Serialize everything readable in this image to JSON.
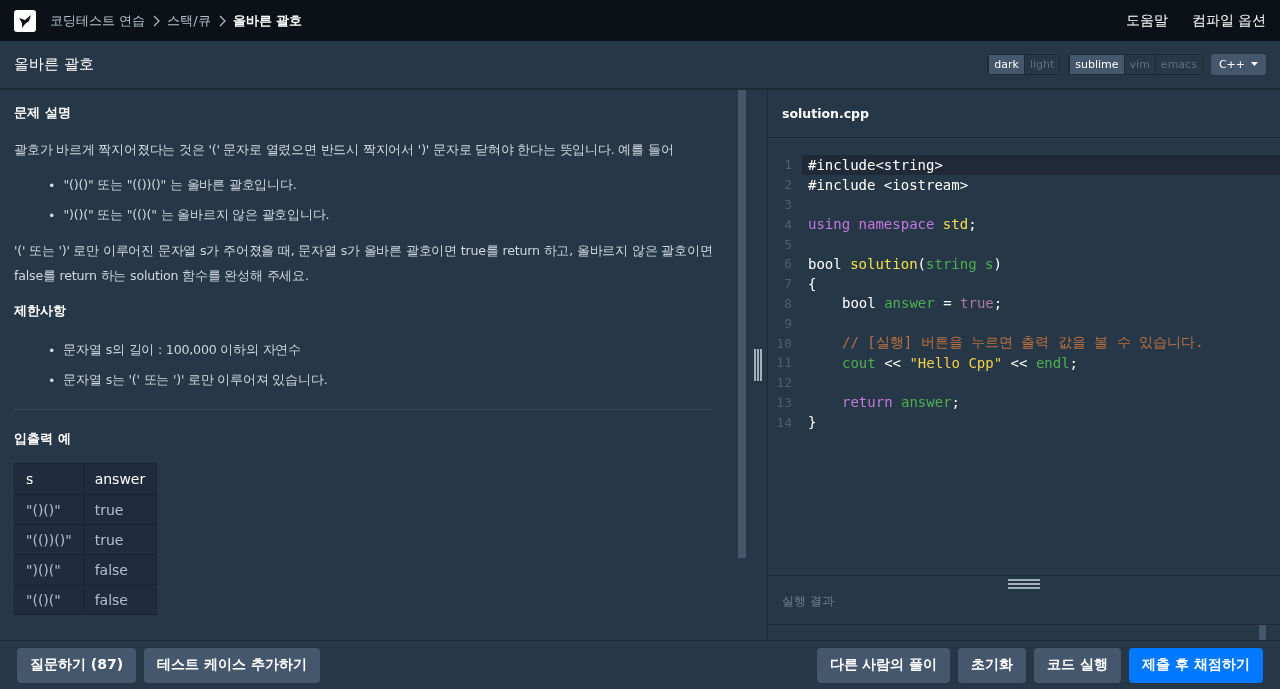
{
  "nav": {
    "breadcrumbs": [
      {
        "label": "코딩테스트 연습",
        "current": false
      },
      {
        "label": "스택/큐",
        "current": false
      },
      {
        "label": "올바른 괄호",
        "current": true
      }
    ],
    "links": [
      "도움말",
      "컴파일 옵션"
    ]
  },
  "header": {
    "title": "올바른 괄호",
    "theme": [
      {
        "label": "dark",
        "selected": true
      },
      {
        "label": "light",
        "selected": false
      }
    ],
    "keymap": [
      {
        "label": "sublime",
        "selected": true
      },
      {
        "label": "vim",
        "selected": false
      },
      {
        "label": "emacs",
        "selected": false
      }
    ],
    "language": "C++"
  },
  "problem": {
    "sections": [
      {
        "heading": "문제 설명",
        "blocks": [
          {
            "kind": "para",
            "text": "괄호가 바르게 짝지어졌다는 것은 '(' 문자로 열렸으면 반드시 짝지어서 ')' 문자로 닫혀야 한다는 뜻입니다. 예를 들어"
          },
          {
            "kind": "list",
            "marker": "•",
            "items": [
              "\"()()\" 또는 \"(())()\" 는 올바른 괄호입니다.",
              "\")()(\" 또는 \"(()(\" 는 올바르지 않은 괄호입니다."
            ]
          },
          {
            "kind": "para",
            "text": "'(' 또는 ')' 로만 이루어진 문자열 s가 주어졌을 때, 문자열 s가 올바른 괄호이면 true를 return 하고, 올바르지 않은 괄호이면 false를 return 하는 solution 함수를 완성해 주세요."
          }
        ]
      },
      {
        "heading": "제한사항",
        "blocks": [
          {
            "kind": "list",
            "marker": "•",
            "items": [
              "문자열 s의 길이 : 100,000 이하의 자연수",
              "문자열 s는 '(' 또는 ')' 로만 이루어져 있습니다."
            ]
          }
        ]
      }
    ],
    "examples": {
      "heading": "입출력 예",
      "columns": [
        "s",
        "answer"
      ],
      "rows": [
        [
          "\"()()\"",
          "true"
        ],
        [
          "\"(())()\"",
          "true"
        ],
        [
          "\")()(\"",
          "false"
        ],
        [
          "\"(()(\"",
          "false"
        ]
      ]
    }
  },
  "editor": {
    "filename": "solution.cpp",
    "lines": [
      {
        "number": "1",
        "current": true,
        "tokens": [
          {
            "kind": "plain",
            "text": "#include<string>"
          }
        ]
      },
      {
        "number": "2",
        "current": false,
        "tokens": [
          {
            "kind": "plain",
            "text": "#include <iostream>"
          }
        ]
      },
      {
        "number": "3",
        "current": false
      },
      {
        "number": "4",
        "current": false,
        "tokens": [
          {
            "kind": "keyword",
            "text": "using namespace "
          },
          {
            "kind": "func",
            "text": "std"
          },
          {
            "kind": "plain",
            "text": ";"
          }
        ]
      },
      {
        "number": "5",
        "current": false
      },
      {
        "number": "6",
        "current": false,
        "tokens": [
          {
            "kind": "plain",
            "text": "bool "
          },
          {
            "kind": "func",
            "text": "solution"
          },
          {
            "kind": "plain",
            "text": "("
          },
          {
            "kind": "type",
            "text": "string s"
          },
          {
            "kind": "plain",
            "text": ")"
          }
        ]
      },
      {
        "number": "7",
        "current": false,
        "tokens": [
          {
            "kind": "plain",
            "text": "{"
          }
        ]
      },
      {
        "number": "8",
        "current": false,
        "indented": true,
        "tokens": [
          {
            "kind": "plain",
            "text": "bool "
          },
          {
            "kind": "type",
            "text": "answer"
          },
          {
            "kind": "plain",
            "text": " = "
          },
          {
            "kind": "literal",
            "text": "true"
          },
          {
            "kind": "plain",
            "text": ";"
          }
        ]
      },
      {
        "number": "9",
        "current": false
      },
      {
        "number": "10",
        "current": false,
        "indented": true,
        "tokens": [
          {
            "kind": "comment",
            "text": "// [실행] 버튼을 누르면 출력 값을 볼 수 있습니다."
          }
        ]
      },
      {
        "number": "11",
        "current": false,
        "indented": true,
        "tokens": [
          {
            "kind": "type",
            "text": "cout"
          },
          {
            "kind": "plain",
            "text": " << "
          },
          {
            "kind": "string",
            "text": "\"Hello Cpp\""
          },
          {
            "kind": "plain",
            "text": " << "
          },
          {
            "kind": "type",
            "text": "endl"
          },
          {
            "kind": "plain",
            "text": ";"
          }
        ]
      },
      {
        "number": "12",
        "current": false
      },
      {
        "number": "13",
        "current": false,
        "indented": true,
        "tokens": [
          {
            "kind": "keyword",
            "text": "return "
          },
          {
            "kind": "type",
            "text": "answer"
          },
          {
            "kind": "plain",
            "text": ";"
          }
        ]
      },
      {
        "number": "14",
        "current": false,
        "tokens": [
          {
            "kind": "plain",
            "text": "}"
          }
        ]
      }
    ],
    "result_label": "실행 결과"
  },
  "footer": {
    "left_buttons": [
      "질문하기 (87)",
      "테스트 케이스 추가하기"
    ],
    "right_buttons": [
      {
        "label": "다른 사람의 풀이",
        "primary": false
      },
      {
        "label": "초기화",
        "primary": false
      },
      {
        "label": "코드 실행",
        "primary": false
      },
      {
        "label": "제출 후 채점하기",
        "primary": true
      }
    ]
  }
}
